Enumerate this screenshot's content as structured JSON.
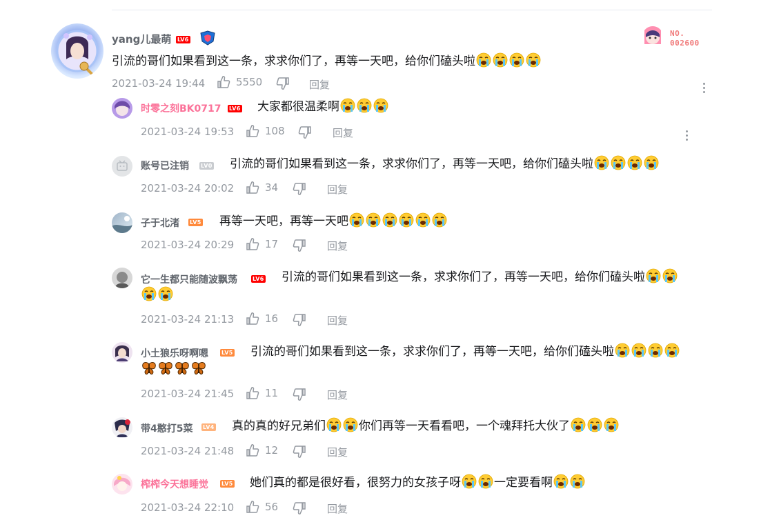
{
  "main_comment": {
    "username": "yang儿最萌",
    "level": "LV6",
    "content": "引流的哥们如果看到这一条，求求你们了，再等一天吧，给你们磕头啦",
    "emoji_count": 4,
    "date": "2021-03-24 19:44",
    "likes": "5550",
    "reply_label": "回复",
    "fan_badge_label": "NO.",
    "fan_badge_number": "002600"
  },
  "replies": [
    {
      "username": "时零之刻BK0717",
      "level": "LV6",
      "content": "大家都很温柔啊",
      "emoji_after": 3,
      "date": "2021-03-24 19:53",
      "likes": "108",
      "reply_label": "回复",
      "pink": true
    },
    {
      "username": "账号已注销",
      "level": "LV0",
      "content": "引流的哥们如果看到这一条，求求你们了，再等一天吧，给你们磕头啦",
      "emoji_after": 4,
      "date": "2021-03-24 20:02",
      "likes": "34",
      "reply_label": "回复"
    },
    {
      "username": "子于北渚",
      "level": "LV5",
      "content": "再等一天吧，再等一天吧",
      "emoji_after": 6,
      "date": "2021-03-24 20:29",
      "likes": "17",
      "reply_label": "回复"
    },
    {
      "username": "它一生都只能随波飘荡",
      "level": "LV6",
      "content": "引流的哥们如果看到这一条，求求你们了，再等一天吧，给你们磕头啦",
      "emoji_after": 2,
      "emoji_line2": 2,
      "date": "2021-03-24 21:13",
      "likes": "16",
      "reply_label": "回复"
    },
    {
      "username": "小土狼乐呀啊嗯",
      "level": "LV5",
      "content": "引流的哥们如果看到这一条，求求你们了，再等一天吧，给你们磕头啦",
      "emoji_after": 4,
      "butterflies_line2": 4,
      "date": "2021-03-24 21:45",
      "likes": "11",
      "reply_label": "回复"
    },
    {
      "username": "带4憨打5菜",
      "level": "LV4",
      "content_a": "真的真的好兄弟们",
      "content_b": "你们再等一天看看吧，一个魂拜托大伙了",
      "date": "2021-03-24 21:48",
      "likes": "12",
      "reply_label": "回复"
    },
    {
      "username": "榨榨今天想睡觉",
      "level": "LV5",
      "content_a": "她们真的都是很好看，很努力的女孩子呀",
      "content_b": "一定要看啊",
      "date": "2021-03-24 22:10",
      "likes": "56",
      "reply_label": "回复",
      "pink": true
    }
  ],
  "colors": {
    "text_primary": "#18191c",
    "text_secondary": "#9499a0",
    "username_grey": "#61666d",
    "username_pink": "#fb7299",
    "lv6": "#ff0000",
    "lv5": "#ff8a3c",
    "lv4": "#ffb37c",
    "lv0": "#c9ccd0"
  },
  "icons": [
    "like-icon",
    "dislike-icon",
    "more-icon",
    "crying-emoji",
    "butterfly-emoji"
  ]
}
